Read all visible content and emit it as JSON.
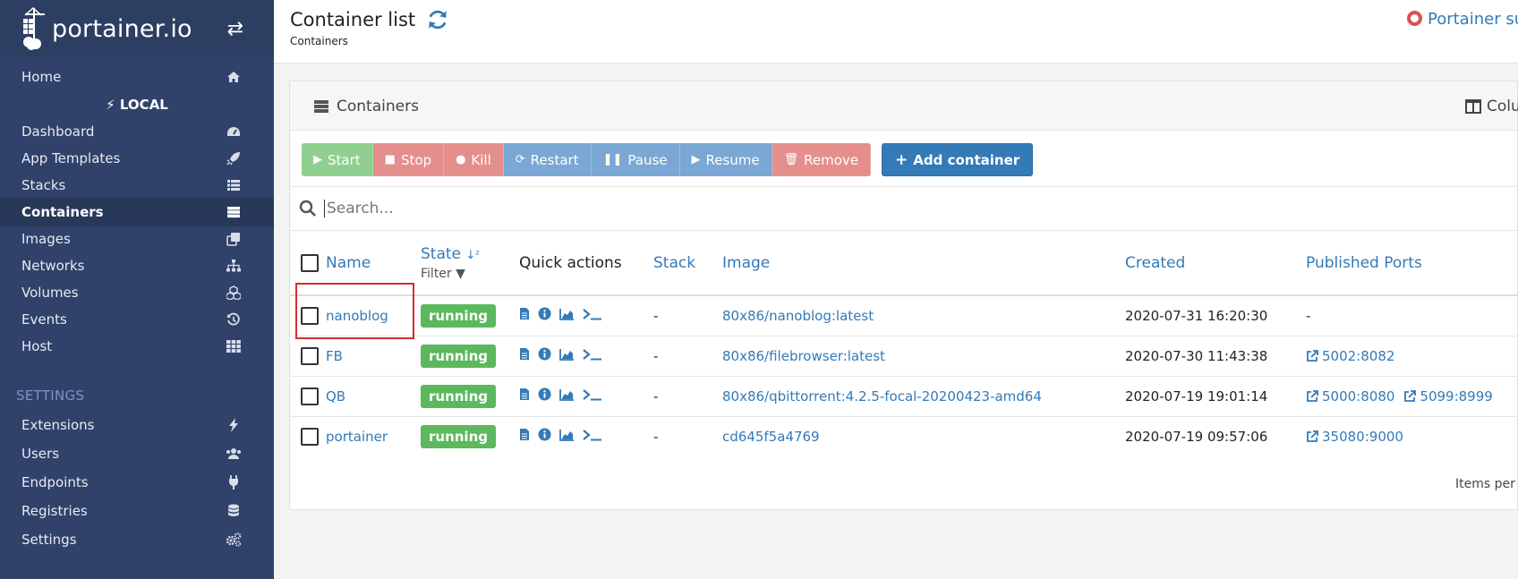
{
  "sidebar": {
    "brand": "portainer.io",
    "endpoint": "LOCAL",
    "settings_header": "SETTINGS",
    "items": [
      {
        "label": "Home",
        "icon": "home-icon"
      },
      {
        "label": "Dashboard",
        "icon": "tachometer-icon"
      },
      {
        "label": "App Templates",
        "icon": "rocket-icon"
      },
      {
        "label": "Stacks",
        "icon": "list-icon"
      },
      {
        "label": "Containers",
        "icon": "server-icon",
        "active": true
      },
      {
        "label": "Images",
        "icon": "clone-icon"
      },
      {
        "label": "Networks",
        "icon": "sitemap-icon"
      },
      {
        "label": "Volumes",
        "icon": "cubes-icon"
      },
      {
        "label": "Events",
        "icon": "history-icon"
      },
      {
        "label": "Host",
        "icon": "th-icon"
      },
      {
        "label": "Extensions",
        "icon": "bolt-icon"
      },
      {
        "label": "Users",
        "icon": "users-icon"
      },
      {
        "label": "Endpoints",
        "icon": "plug-icon"
      },
      {
        "label": "Registries",
        "icon": "database-icon"
      },
      {
        "label": "Settings",
        "icon": "cogs-icon"
      }
    ]
  },
  "header": {
    "title": "Container list",
    "breadcrumb": "Containers",
    "support": "Portainer su"
  },
  "panel": {
    "title": "Containers",
    "columns_label": "Colu",
    "search_placeholder": "Search...",
    "footer": "Items per"
  },
  "toolbar": {
    "start": "Start",
    "stop": "Stop",
    "kill": "Kill",
    "restart": "Restart",
    "pause": "Pause",
    "resume": "Resume",
    "remove": "Remove",
    "add": "Add container"
  },
  "table": {
    "headers": {
      "name": "Name",
      "state": "State",
      "filter": "Filter",
      "quick_actions": "Quick actions",
      "stack": "Stack",
      "image": "Image",
      "created": "Created",
      "ports": "Published Ports"
    },
    "rows": [
      {
        "name": "nanoblog",
        "state": "running",
        "stack": "-",
        "image": "80x86/nanoblog:latest",
        "created": "2020-07-31 16:20:30",
        "ports": [],
        "ports_text": "-"
      },
      {
        "name": "FB",
        "state": "running",
        "stack": "-",
        "image": "80x86/filebrowser:latest",
        "created": "2020-07-30 11:43:38",
        "ports": [
          "5002:8082"
        ],
        "ports_text": ""
      },
      {
        "name": "QB",
        "state": "running",
        "stack": "-",
        "image": "80x86/qbittorrent:4.2.5-focal-20200423-amd64",
        "created": "2020-07-19 19:01:14",
        "ports": [
          "5000:8080",
          "5099:8999"
        ],
        "ports_text": ""
      },
      {
        "name": "portainer",
        "state": "running",
        "stack": "-",
        "image": "cd645f5a4769",
        "created": "2020-07-19 09:57:06",
        "ports": [
          "35080:9000"
        ],
        "ports_text": ""
      }
    ]
  },
  "colors": {
    "sidebar_bg": "#30426a",
    "link": "#337ab7",
    "running": "#5cb85c",
    "start": "#8fcf8f",
    "danger": "#e58f8d",
    "info": "#7aa7d3"
  }
}
